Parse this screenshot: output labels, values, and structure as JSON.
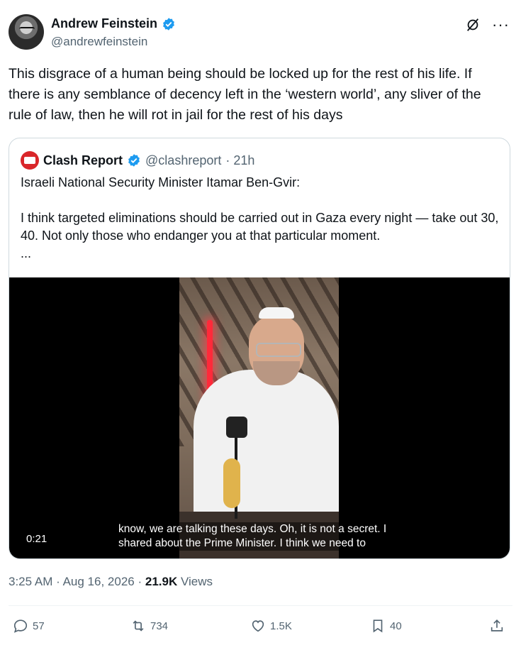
{
  "author": {
    "name": "Andrew Feinstein",
    "handle": "@andrewfeinstein"
  },
  "tweet": {
    "text": "This disgrace of a human being should be locked up for the rest of his life. If there is any semblance of decency left in the ‘western world’, any sliver of the rule of law, then he will rot in jail for the rest of his days"
  },
  "quote": {
    "name": "Clash Report",
    "handle": "@clashreport",
    "time": "· 21h",
    "line1": "Israeli National Security Minister Itamar Ben-Gvir:",
    "line2": "I think targeted eliminations should be carried out in Gaza every night — take out 30, 40. Not only those who endanger you at that particular moment.",
    "ellipsis": "...",
    "video": {
      "duration": "0:21",
      "subtitle_line1": "know, we are talking these days. Oh, it is not a secret. I",
      "subtitle_line2": "shared about the Prime Minister. I think we need to"
    }
  },
  "meta": {
    "time": "3:25 AM",
    "sep1": "·",
    "date": "Aug 16, 2026",
    "sep2": "·",
    "views_count": "21.9K",
    "views_label": "Views"
  },
  "actions": {
    "replies": "57",
    "reposts": "734",
    "likes": "1.5K",
    "bookmarks": "40"
  },
  "colors": {
    "accent": "#1d9bf0",
    "secondary_text": "#536471",
    "brand_red": "#d9262a"
  }
}
